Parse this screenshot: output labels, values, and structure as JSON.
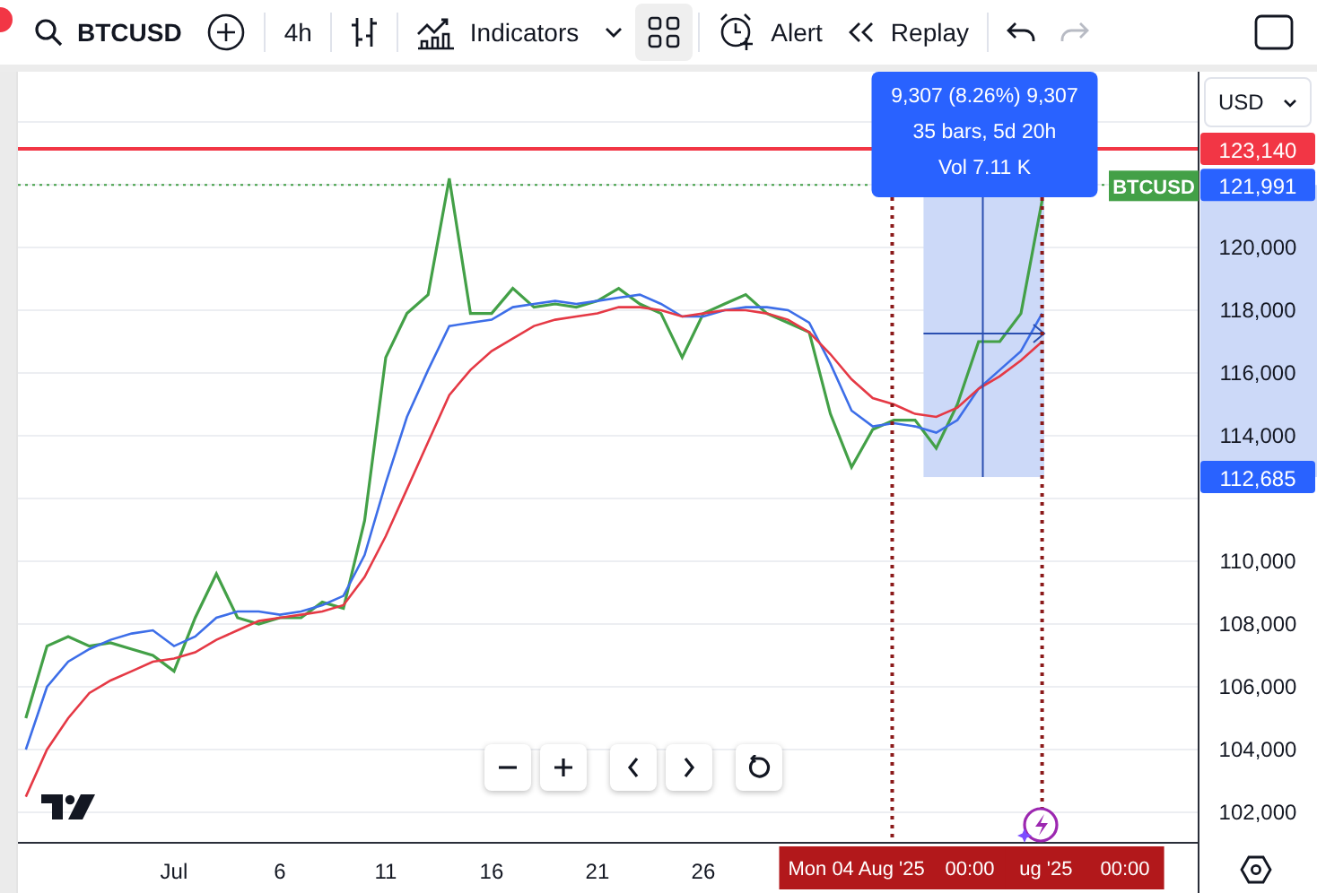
{
  "toolbar": {
    "notification_dot": true,
    "symbol": "BTCUSD",
    "interval": "4h",
    "indicators": "Indicators",
    "layout_selected": true,
    "alert": "Alert",
    "replay": "Replay",
    "redo_disabled": true
  },
  "chart": {
    "currency": "USD",
    "chart_data": {
      "type": "line",
      "categories": [
        null,
        null,
        null,
        null,
        null,
        null,
        null,
        "Jul",
        null,
        null,
        null,
        null,
        "6",
        null,
        null,
        null,
        null,
        "11",
        null,
        null,
        null,
        null,
        "16",
        null,
        null,
        null,
        null,
        "21",
        null,
        null,
        null,
        null,
        "26",
        null,
        null,
        null,
        null,
        null,
        null,
        null,
        null,
        null,
        null,
        null,
        null,
        null,
        null,
        null,
        null
      ],
      "series": [
        {
          "color": "#43a047",
          "values": [
            105000,
            107300,
            107600,
            107300,
            107400,
            107200,
            107000,
            106500,
            108200,
            109600,
            108200,
            108000,
            108200,
            108200,
            108700,
            108500,
            111300,
            116500,
            117900,
            118500,
            122200,
            117900,
            117900,
            118700,
            118100,
            118200,
            118100,
            118300,
            118700,
            118200,
            117900,
            116500,
            117900,
            118200,
            118500,
            117900,
            117600,
            117300,
            114700,
            113000,
            114200,
            114500,
            114500,
            113600,
            115000,
            117000,
            117000,
            117900,
            121500
          ]
        },
        {
          "color": "#3d6ee8",
          "values": [
            104000,
            106000,
            106800,
            107200,
            107500,
            107700,
            107800,
            107300,
            107600,
            108200,
            108400,
            108400,
            108300,
            108400,
            108600,
            108900,
            110200,
            112500,
            114600,
            116100,
            117500,
            117600,
            117700,
            118100,
            118200,
            118300,
            118200,
            118300,
            118400,
            118500,
            118200,
            117800,
            117800,
            118000,
            118100,
            118100,
            118000,
            117600,
            116300,
            114800,
            114300,
            114400,
            114300,
            114100,
            114500,
            115500,
            116100,
            116700,
            117900
          ]
        },
        {
          "color": "#e53945",
          "values": [
            102500,
            104000,
            105000,
            105800,
            106200,
            106500,
            106800,
            106900,
            107100,
            107500,
            107800,
            108100,
            108200,
            108300,
            108400,
            108600,
            109500,
            110800,
            112300,
            113800,
            115300,
            116100,
            116700,
            117100,
            117500,
            117700,
            117800,
            117900,
            118100,
            118100,
            118000,
            117800,
            117900,
            118000,
            118000,
            117900,
            117700,
            117300,
            116600,
            115800,
            115200,
            115000,
            114700,
            114600,
            114900,
            115500,
            115900,
            116400,
            117000
          ]
        }
      ],
      "ylim": [
        101030,
        125600
      ],
      "grid": true,
      "ref_lines": [
        {
          "axis": "y",
          "value": 123140,
          "label": "123,140",
          "color": "#f23645"
        },
        {
          "axis": "y",
          "value": 121991,
          "label": "121,991",
          "color": "#43a047"
        }
      ],
      "yticks": [
        {
          "value": 102000,
          "label": "102,000"
        },
        {
          "value": 104000,
          "label": "104,000"
        },
        {
          "value": 106000,
          "label": "106,000"
        },
        {
          "value": 108000,
          "label": "108,000"
        },
        {
          "value": 110000,
          "label": "110,000"
        },
        {
          "value": 114000,
          "label": "114,000"
        },
        {
          "value": 116000,
          "label": "116,000"
        },
        {
          "value": 118000,
          "label": "118,000"
        },
        {
          "value": 120000,
          "label": "120,000"
        }
      ]
    },
    "overlays": [
      {
        "kind": "measure",
        "label": "112,685",
        "lines": [
          "9,307 (8.26%) 9,307",
          "35 bars, 5d 20h",
          "Vol 7.11 K"
        ]
      },
      {
        "kind": "symbol_badge",
        "label": "BTCUSD"
      },
      {
        "kind": "date_marker",
        "date": "Mon 04 Aug '25",
        "time": "00:00",
        "covered": false
      },
      {
        "kind": "date_marker",
        "date": "ug '25",
        "time": "00:00",
        "covered": true
      }
    ]
  }
}
